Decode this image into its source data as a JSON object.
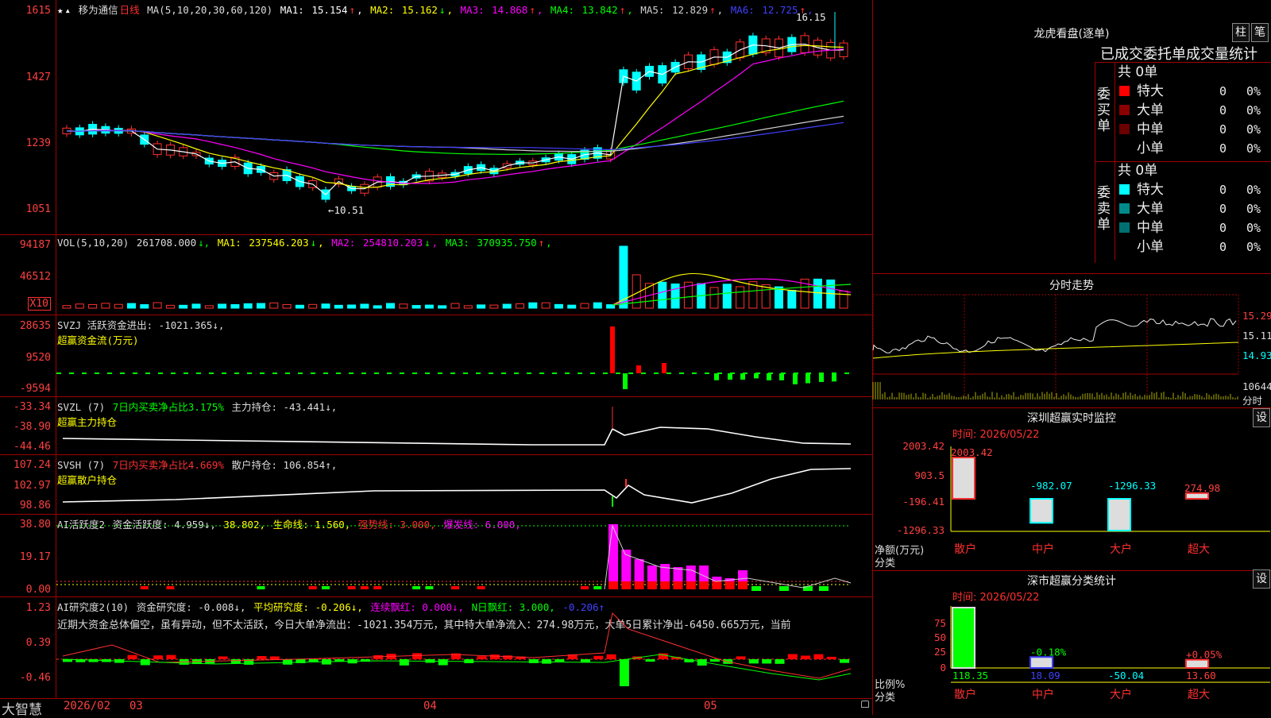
{
  "kline": {
    "stock_name": "移为通信",
    "period": "日线",
    "ma_label": "MA(5,10,20,30,60,120)",
    "ma": [
      {
        "name": "MA1:",
        "value": "15.154",
        "arrow": "↑",
        "color": "#ffffff"
      },
      {
        "name": "MA2:",
        "value": "15.162",
        "arrow": "↓",
        "color": "#ffff00"
      },
      {
        "name": "MA3:",
        "value": "14.868",
        "arrow": "↑",
        "color": "#ff00ff"
      },
      {
        "name": "MA4:",
        "value": "13.842",
        "arrow": "↑",
        "color": "#00ff00"
      },
      {
        "name": "MA5:",
        "value": "12.829",
        "arrow": "↑",
        "color": "#d0d0d0"
      },
      {
        "name": "MA6:",
        "value": "12.725",
        "arrow": "↑",
        "color": "#4040ff"
      }
    ],
    "y_labels": [
      "1615",
      "1427",
      "1239",
      "1051"
    ],
    "high_marker": "16.15",
    "low_marker": "10.51"
  },
  "vol": {
    "label": "VOL(5,10,20)",
    "value": "261708.000",
    "items": [
      {
        "name": "MA1:",
        "value": "237546.203",
        "arrow": "↓",
        "color": "#ffff00"
      },
      {
        "name": "MA2:",
        "value": "254810.203",
        "arrow": "↓",
        "color": "#ff00ff"
      },
      {
        "name": "MA3:",
        "value": "370935.750",
        "arrow": "↑",
        "color": "#00ff00"
      }
    ],
    "y_labels": [
      "94187",
      "46512"
    ],
    "unit": "X10"
  },
  "svzj": {
    "line1": "SVZJ  活跃资金进出: -1021.365↓,",
    "line2": "超赢资金流(万元)",
    "y_labels": [
      "28635",
      "9520",
      "-9594"
    ]
  },
  "svzl": {
    "prefix": "SVZL (7)",
    "green_text": "7日内买卖净占比3.175%",
    "rest": "主力持仓: -43.441↓,",
    "line2": "超赢主力持仓",
    "y_labels": [
      "-33.34",
      "-38.90",
      "-44.46"
    ]
  },
  "svsh": {
    "prefix": "SVSH (7)",
    "red_text": "7日内买卖净占比4.669%",
    "rest": "散户持仓: 106.854↑,",
    "line2": "超赢散户持仓",
    "y_labels": [
      "107.24",
      "102.97",
      "98.86"
    ]
  },
  "ai1": {
    "prefix": "AI活跃度2",
    "t1": "资金活跃度: 4.959↓,",
    "t2": "38.802,",
    "t3": "生命线: 1.560,",
    "t4": "强势线: 3.000,",
    "t5": "爆发线: 6.000,",
    "y_labels": [
      "38.80",
      "19.17",
      "0.00"
    ]
  },
  "ai2": {
    "prefix": "AI研究度2(10)",
    "t1": "资金研究度: -0.008↓,",
    "t2": "平均研究度: -0.206↓,",
    "t3": "连续飘红: 0.000↓,",
    "t4": "N日飘红: 3.000,",
    "t5": "-0.206↑",
    "comment": "近期大资金总体偏空，虽有异动，但不太活跃，今日大单净流出：-1021.354万元，其中特大单净流入：274.98万元，大单5日累计净出-6450.665万元，当前",
    "y_labels": [
      "1.23",
      "0.39",
      "-0.46"
    ]
  },
  "xaxis": {
    "brand": "大智慧",
    "labels": [
      "2026/02",
      "03",
      "04",
      "05"
    ]
  },
  "lhb": {
    "title": "龙虎看盘(逐单)",
    "btn1": "柱",
    "btn2": "笔",
    "subtitle": "已成交委托单成交量统计",
    "buy_label": "委买单",
    "sell_label": "委卖单",
    "buy_total": "共 0单",
    "sell_total": "共 0单",
    "buy_rows": [
      {
        "name": "特大",
        "count": "0",
        "pct": "0%",
        "color": "#ff0000"
      },
      {
        "name": "大单",
        "count": "0",
        "pct": "0%",
        "color": "#8b0000"
      },
      {
        "name": "中单",
        "count": "0",
        "pct": "0%",
        "color": "#6a0000"
      },
      {
        "name": "小单",
        "count": "0",
        "pct": "0%",
        "color": "#000000"
      }
    ],
    "sell_rows": [
      {
        "name": "特大",
        "count": "0",
        "pct": "0%",
        "color": "#00ffff"
      },
      {
        "name": "大单",
        "count": "0",
        "pct": "0%",
        "color": "#008b8b"
      },
      {
        "name": "中单",
        "count": "0",
        "pct": "0%",
        "color": "#007070"
      },
      {
        "name": "小单",
        "count": "0",
        "pct": "0%",
        "color": "#000000"
      }
    ]
  },
  "intraday": {
    "title": "分时走势",
    "labels": [
      "15.29",
      "15.11",
      "14.93"
    ],
    "vol_label": "10644",
    "unit": "分时"
  },
  "monitor": {
    "title": "深圳超赢实时监控",
    "btn": "设",
    "time_label": "时间: 2026/05/22",
    "y_labels": [
      "2003.42",
      "903.5",
      "-196.41",
      "-1296.33"
    ],
    "unit_label": "净额(万元)",
    "axis_label": "分类",
    "bars": [
      {
        "cat": "散户",
        "value": 2003.42,
        "label": "2003.42"
      },
      {
        "cat": "中户",
        "value": -982.07,
        "label": "-982.07"
      },
      {
        "cat": "大户",
        "value": -1296.33,
        "label": "-1296.33"
      },
      {
        "cat": "超大",
        "value": 274.98,
        "label": "274.98"
      }
    ]
  },
  "classify": {
    "title": "深市超赢分类统计",
    "btn": "设",
    "time_label": "时间: 2026/05/22",
    "y_labels": [
      "75",
      "50",
      "25",
      "0"
    ],
    "unit_label": "比例%",
    "axis_label": "分类",
    "bars": [
      {
        "cat": "散户",
        "value": 118.35,
        "label": "118.35",
        "top_label": ""
      },
      {
        "cat": "中户",
        "value": 18.09,
        "label": "18.09",
        "top_label": "-0.18%"
      },
      {
        "cat": "大户",
        "value": -50.04,
        "label": "-50.04",
        "top_label": ""
      },
      {
        "cat": "超大",
        "value": 13.6,
        "label": "13.60",
        "top_label": "+0.05%"
      }
    ]
  }
}
